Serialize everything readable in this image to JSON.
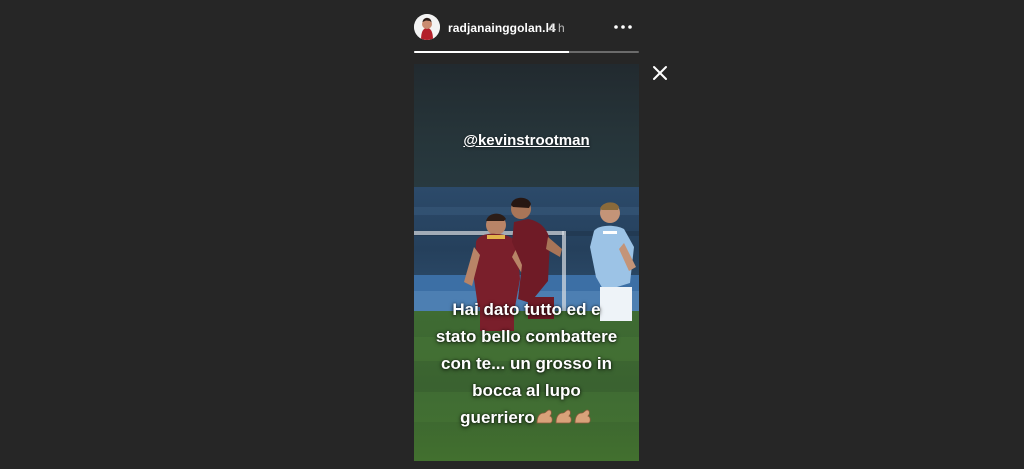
{
  "story": {
    "username": "radjanainggolan.l4",
    "timestamp": "4 h",
    "progress_fraction": 0.69,
    "mention": "@kevinstrootman",
    "caption": "Hai dato tutto ed e\nstato bello combattere\ncon te... un grosso in\nbocca al lupo\nguerriero",
    "caption_emoji": "flexed-biceps-emoji x3"
  },
  "icons": {
    "more": "more-options-icon",
    "close": "close-icon"
  },
  "colors": {
    "background": "#262626",
    "progress_track": "#6b6b6b",
    "progress_fill": "#ffffff",
    "text": "#ffffff",
    "muted_text": "#bdbdbd",
    "roma_kit": "#7a1f2b",
    "lazio_kit": "#9cc3e6",
    "pitch": "#3f6b2e"
  }
}
